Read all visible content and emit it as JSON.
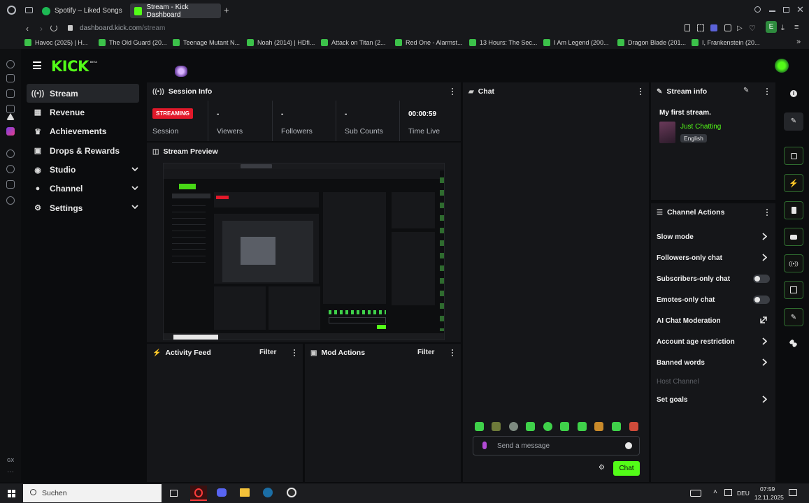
{
  "browser": {
    "tabs": [
      {
        "label": "Spotify – Liked Songs",
        "active": false,
        "icon_color": "#1db954"
      },
      {
        "label": "Stream - Kick Dashboard",
        "active": true,
        "icon_color": "#53fc18"
      }
    ],
    "new_tab": "+",
    "address": {
      "host": "dashboard.kick.com",
      "path": "/stream"
    },
    "bookmarks": [
      "Havoc (2025) | H...",
      "The Old Guard (20...",
      "Teenage Mutant N...",
      "Noah (2014) | HDfi...",
      "Attack on Titan (2...",
      "Red One - Alarmst...",
      "13 Hours: The Sec...",
      "I Am Legend (200...",
      "Dragon Blade (201...",
      "I, Frankenstein (20..."
    ],
    "profile_letter": "E"
  },
  "kick": {
    "logo": "KICK",
    "logo_badge": "BETA",
    "accent": "#53fc18",
    "nav": [
      {
        "label": "Stream",
        "icon": "broadcast-icon",
        "selected": true,
        "expandable": false
      },
      {
        "label": "Revenue",
        "icon": "chart-icon",
        "selected": false,
        "expandable": false
      },
      {
        "label": "Achievements",
        "icon": "trophy-icon",
        "selected": false,
        "expandable": false
      },
      {
        "label": "Drops & Rewards",
        "icon": "gift-icon",
        "selected": false,
        "expandable": false
      },
      {
        "label": "Studio",
        "icon": "studio-icon",
        "selected": false,
        "expandable": true
      },
      {
        "label": "Channel",
        "icon": "person-icon",
        "selected": false,
        "expandable": true
      },
      {
        "label": "Settings",
        "icon": "gear-icon",
        "selected": false,
        "expandable": true
      }
    ]
  },
  "session": {
    "title": "Session Info",
    "status_badge": "STREAMING",
    "session_label": "Session",
    "stats": [
      {
        "value": "-",
        "label": "Viewers"
      },
      {
        "value": "-",
        "label": "Followers"
      },
      {
        "value": "-",
        "label": "Sub Counts"
      },
      {
        "value": "00:00:59",
        "label": "Time Live"
      }
    ]
  },
  "preview": {
    "title": "Stream Preview"
  },
  "activity": {
    "title": "Activity Feed",
    "filter": "Filter"
  },
  "mod_actions": {
    "title": "Mod Actions",
    "filter": "Filter"
  },
  "chat": {
    "title": "Chat",
    "placeholder": "Send a message",
    "send_label": "Chat"
  },
  "stream_info": {
    "title": "Stream info",
    "stream_title": "My first stream.",
    "category": "Just Chatting",
    "language": "English"
  },
  "channel_actions": {
    "title": "Channel Actions",
    "items": [
      {
        "label": "Slow mode",
        "control": "chevron",
        "disabled": false
      },
      {
        "label": "Followers-only chat",
        "control": "chevron",
        "disabled": false
      },
      {
        "label": "Subscribers-only chat",
        "control": "toggle",
        "disabled": false
      },
      {
        "label": "Emotes-only chat",
        "control": "toggle",
        "disabled": false
      },
      {
        "label": "AI Chat Moderation",
        "control": "external",
        "disabled": false
      },
      {
        "label": "Account age restriction",
        "control": "chevron",
        "disabled": false
      },
      {
        "label": "Banned words",
        "control": "chevron",
        "disabled": false
      },
      {
        "label": "Host Channel",
        "control": "none",
        "disabled": true
      },
      {
        "label": "Set goals",
        "control": "chevron",
        "disabled": false
      }
    ]
  },
  "taskbar": {
    "search": "Suchen",
    "lang": "DEU",
    "time": "07:59",
    "date": "12.11.2025"
  }
}
